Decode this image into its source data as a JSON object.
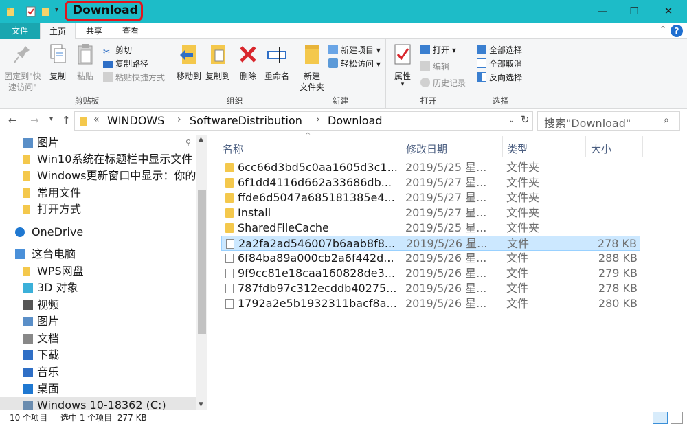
{
  "window": {
    "title": "Download",
    "minimize": "—",
    "maximize": "☐",
    "close": "✕"
  },
  "tabs": {
    "file": "文件",
    "home": "主页",
    "share": "共享",
    "view": "查看",
    "help": "?"
  },
  "ribbon": {
    "clipboard": {
      "pin": "固定到\"快速访问\"",
      "copy": "复制",
      "paste": "粘贴",
      "cut": "剪切",
      "copy_path": "复制路径",
      "paste_shortcut": "粘贴快捷方式",
      "label": "剪贴板"
    },
    "organize": {
      "move_to": "移动到",
      "copy_to": "复制到",
      "delete": "删除",
      "rename": "重命名",
      "label": "组织"
    },
    "new": {
      "new_folder": "新建\n文件夹",
      "new_item": "新建项目",
      "easy_access": "轻松访问",
      "label": "新建"
    },
    "open": {
      "properties": "属性",
      "open": "打开",
      "edit": "编辑",
      "history": "历史记录",
      "label": "打开"
    },
    "select": {
      "select_all": "全部选择",
      "select_none": "全部取消",
      "invert": "反向选择",
      "label": "选择"
    }
  },
  "address": {
    "crumbs": [
      "WINDOWS",
      "SoftwareDistribution",
      "Download"
    ],
    "overflow": "«",
    "search_placeholder": "搜索\"Download\""
  },
  "nav": [
    {
      "label": "图片",
      "icon": "pictures-icon",
      "pinned": true
    },
    {
      "label": "Win10系统在标题栏中显示文件",
      "icon": "folder-icon"
    },
    {
      "label": "Windows更新窗口中显示：你的",
      "icon": "folder-icon"
    },
    {
      "label": "常用文件",
      "icon": "folder-icon"
    },
    {
      "label": "打开方式",
      "icon": "folder-icon"
    },
    {
      "label": "OneDrive",
      "icon": "cloud-icon"
    },
    {
      "label": "这台电脑",
      "icon": "computer-icon"
    },
    {
      "label": "WPS网盘",
      "icon": "folder-icon"
    },
    {
      "label": "3D 对象",
      "icon": "3d-objects-icon"
    },
    {
      "label": "视频",
      "icon": "video-icon"
    },
    {
      "label": "图片",
      "icon": "pictures-icon"
    },
    {
      "label": "文档",
      "icon": "documents-icon"
    },
    {
      "label": "下载",
      "icon": "download-icon"
    },
    {
      "label": "音乐",
      "icon": "music-icon"
    },
    {
      "label": "桌面",
      "icon": "desktop-icon"
    },
    {
      "label": "Windows 10-18362 (C:)",
      "icon": "drive-icon"
    }
  ],
  "columns": {
    "name": "名称",
    "date": "修改日期",
    "type": "类型",
    "size": "大小"
  },
  "files": [
    {
      "name": "6cc66d3bd5c0aa1605d3c1...",
      "date": "2019/5/25 星...",
      "type": "文件夹",
      "size": "",
      "kind": "folder"
    },
    {
      "name": "6f1dd4116d662a33686db...",
      "date": "2019/5/27 星...",
      "type": "文件夹",
      "size": "",
      "kind": "folder"
    },
    {
      "name": "ffde6d5047a685181385e4...",
      "date": "2019/5/27 星...",
      "type": "文件夹",
      "size": "",
      "kind": "folder"
    },
    {
      "name": "Install",
      "date": "2019/5/27 星...",
      "type": "文件夹",
      "size": "",
      "kind": "folder"
    },
    {
      "name": "SharedFileCache",
      "date": "2019/5/25 星...",
      "type": "文件夹",
      "size": "",
      "kind": "folder"
    },
    {
      "name": "2a2fa2ad546007b6aab8f8...",
      "date": "2019/5/26 星...",
      "type": "文件",
      "size": "278 KB",
      "kind": "file",
      "selected": true
    },
    {
      "name": "6f84ba89a000cb2a6f442d...",
      "date": "2019/5/26 星...",
      "type": "文件",
      "size": "288 KB",
      "kind": "file"
    },
    {
      "name": "9f9cc81e18caa160828de3...",
      "date": "2019/5/26 星...",
      "type": "文件",
      "size": "279 KB",
      "kind": "file"
    },
    {
      "name": "787fdb97c312ecddb40275...",
      "date": "2019/5/26 星...",
      "type": "文件",
      "size": "278 KB",
      "kind": "file"
    },
    {
      "name": "1792a2e5b1932311bacf8a...",
      "date": "2019/5/26 星...",
      "type": "文件",
      "size": "280 KB",
      "kind": "file"
    }
  ],
  "status": {
    "count": "10 个项目",
    "selected": "选中 1 个项目  277 KB"
  },
  "colors": {
    "titlebar": "#1dbcc8",
    "file_tab": "#1aa6b0",
    "highlight_box": "#e4151c",
    "selection": "#cce8ff"
  }
}
